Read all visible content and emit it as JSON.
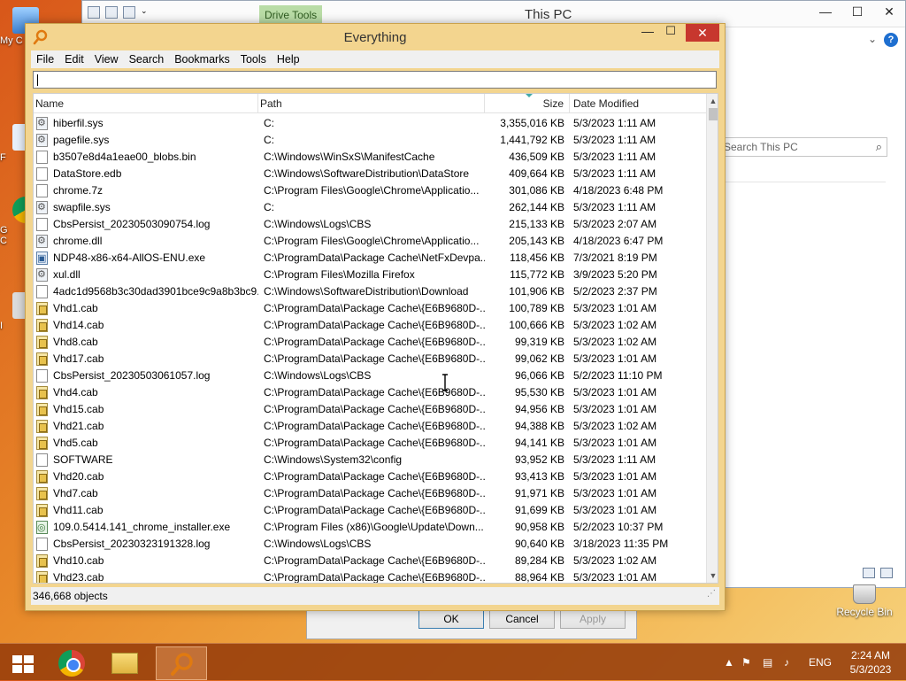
{
  "desktop": {
    "icons": [
      {
        "label": "My C"
      },
      {
        "label": "F"
      },
      {
        "label": "G"
      },
      {
        "label": "C"
      },
      {
        "label": "I"
      }
    ],
    "recycle_bin": "Recycle Bin"
  },
  "explorer": {
    "title": "This PC",
    "drive_tools": "Drive Tools",
    "search_placeholder": "Search This PC",
    "help": "?",
    "minimize": "—",
    "maximize": "☐",
    "close": "✕",
    "chevron": "⌄"
  },
  "properties_dialog": {
    "ok": "OK",
    "cancel": "Cancel",
    "apply": "Apply"
  },
  "everything": {
    "title": "Everything",
    "minimize": "—",
    "maximize": "☐",
    "close": "✕",
    "menu": [
      "File",
      "Edit",
      "View",
      "Search",
      "Bookmarks",
      "Tools",
      "Help"
    ],
    "search_value": "",
    "columns": {
      "name": "Name",
      "path": "Path",
      "size": "Size",
      "date": "Date Modified"
    },
    "rows": [
      {
        "icon": "system-file-icon",
        "name": "hiberfil.sys",
        "path": "C:",
        "size": "3,355,016 KB",
        "date": "5/3/2023 1:11 AM"
      },
      {
        "icon": "system-file-icon",
        "name": "pagefile.sys",
        "path": "C:",
        "size": "1,441,792 KB",
        "date": "5/3/2023 1:11 AM"
      },
      {
        "icon": "file-icon",
        "name": "b3507e8d4a1eae00_blobs.bin",
        "path": "C:\\Windows\\WinSxS\\ManifestCache",
        "size": "436,509 KB",
        "date": "5/3/2023 1:11 AM"
      },
      {
        "icon": "file-icon",
        "name": "DataStore.edb",
        "path": "C:\\Windows\\SoftwareDistribution\\DataStore",
        "size": "409,664 KB",
        "date": "5/3/2023 1:11 AM"
      },
      {
        "icon": "file-icon",
        "name": "chrome.7z",
        "path": "C:\\Program Files\\Google\\Chrome\\Applicatio...",
        "size": "301,086 KB",
        "date": "4/18/2023 6:48 PM"
      },
      {
        "icon": "system-file-icon",
        "name": "swapfile.sys",
        "path": "C:",
        "size": "262,144 KB",
        "date": "5/3/2023 1:11 AM"
      },
      {
        "icon": "file-icon",
        "name": "CbsPersist_20230503090754.log",
        "path": "C:\\Windows\\Logs\\CBS",
        "size": "215,133 KB",
        "date": "5/3/2023 2:07 AM"
      },
      {
        "icon": "system-file-icon",
        "name": "chrome.dll",
        "path": "C:\\Program Files\\Google\\Chrome\\Applicatio...",
        "size": "205,143 KB",
        "date": "4/18/2023 6:47 PM"
      },
      {
        "icon": "exe-icon",
        "name": "NDP48-x86-x64-AllOS-ENU.exe",
        "path": "C:\\ProgramData\\Package Cache\\NetFxDevpa...",
        "size": "118,456 KB",
        "date": "7/3/2021 8:19 PM"
      },
      {
        "icon": "system-file-icon",
        "name": "xul.dll",
        "path": "C:\\Program Files\\Mozilla Firefox",
        "size": "115,772 KB",
        "date": "3/9/2023 5:20 PM"
      },
      {
        "icon": "file-icon",
        "name": "4adc1d9568b3c30dad3901bce9c9a8b3bc9...",
        "path": "C:\\Windows\\SoftwareDistribution\\Download",
        "size": "101,906 KB",
        "date": "5/2/2023 2:37 PM"
      },
      {
        "icon": "cab-icon",
        "name": "Vhd1.cab",
        "path": "C:\\ProgramData\\Package Cache\\{E6B9680D-...",
        "size": "100,789 KB",
        "date": "5/3/2023 1:01 AM"
      },
      {
        "icon": "cab-icon",
        "name": "Vhd14.cab",
        "path": "C:\\ProgramData\\Package Cache\\{E6B9680D-...",
        "size": "100,666 KB",
        "date": "5/3/2023 1:02 AM"
      },
      {
        "icon": "cab-icon",
        "name": "Vhd8.cab",
        "path": "C:\\ProgramData\\Package Cache\\{E6B9680D-...",
        "size": "99,319 KB",
        "date": "5/3/2023 1:02 AM"
      },
      {
        "icon": "cab-icon",
        "name": "Vhd17.cab",
        "path": "C:\\ProgramData\\Package Cache\\{E6B9680D-...",
        "size": "99,062 KB",
        "date": "5/3/2023 1:01 AM"
      },
      {
        "icon": "file-icon",
        "name": "CbsPersist_20230503061057.log",
        "path": "C:\\Windows\\Logs\\CBS",
        "size": "96,066 KB",
        "date": "5/2/2023 11:10 PM"
      },
      {
        "icon": "cab-icon",
        "name": "Vhd4.cab",
        "path": "C:\\ProgramData\\Package Cache\\{E6B9680D-...",
        "size": "95,530 KB",
        "date": "5/3/2023 1:01 AM"
      },
      {
        "icon": "cab-icon",
        "name": "Vhd15.cab",
        "path": "C:\\ProgramData\\Package Cache\\{E6B9680D-...",
        "size": "94,956 KB",
        "date": "5/3/2023 1:01 AM"
      },
      {
        "icon": "cab-icon",
        "name": "Vhd21.cab",
        "path": "C:\\ProgramData\\Package Cache\\{E6B9680D-...",
        "size": "94,388 KB",
        "date": "5/3/2023 1:02 AM"
      },
      {
        "icon": "cab-icon",
        "name": "Vhd5.cab",
        "path": "C:\\ProgramData\\Package Cache\\{E6B9680D-...",
        "size": "94,141 KB",
        "date": "5/3/2023 1:01 AM"
      },
      {
        "icon": "file-icon",
        "name": "SOFTWARE",
        "path": "C:\\Windows\\System32\\config",
        "size": "93,952 KB",
        "date": "5/3/2023 1:11 AM"
      },
      {
        "icon": "cab-icon",
        "name": "Vhd20.cab",
        "path": "C:\\ProgramData\\Package Cache\\{E6B9680D-...",
        "size": "93,413 KB",
        "date": "5/3/2023 1:01 AM"
      },
      {
        "icon": "cab-icon",
        "name": "Vhd7.cab",
        "path": "C:\\ProgramData\\Package Cache\\{E6B9680D-...",
        "size": "91,971 KB",
        "date": "5/3/2023 1:01 AM"
      },
      {
        "icon": "cab-icon",
        "name": "Vhd11.cab",
        "path": "C:\\ProgramData\\Package Cache\\{E6B9680D-...",
        "size": "91,699 KB",
        "date": "5/3/2023 1:01 AM"
      },
      {
        "icon": "installer-icon",
        "name": "109.0.5414.141_chrome_installer.exe",
        "path": "C:\\Program Files (x86)\\Google\\Update\\Down...",
        "size": "90,958 KB",
        "date": "5/2/2023 10:37 PM"
      },
      {
        "icon": "file-icon",
        "name": "CbsPersist_20230323191328.log",
        "path": "C:\\Windows\\Logs\\CBS",
        "size": "90,640 KB",
        "date": "3/18/2023 11:35 PM"
      },
      {
        "icon": "cab-icon",
        "name": "Vhd10.cab",
        "path": "C:\\ProgramData\\Package Cache\\{E6B9680D-...",
        "size": "89,284 KB",
        "date": "5/3/2023 1:02 AM"
      },
      {
        "icon": "cab-icon",
        "name": "Vhd23.cab",
        "path": "C:\\ProgramData\\Package Cache\\{E6B9680D-...",
        "size": "88,964 KB",
        "date": "5/3/2023 1:01 AM"
      }
    ],
    "status": "346,668 objects"
  },
  "taskbar": {
    "items": [
      "start-button",
      "chrome-icon",
      "file-explorer-icon",
      "everything-icon"
    ],
    "tray": {
      "language": "ENG",
      "time": "2:24 AM",
      "date": "5/3/2023"
    }
  },
  "colors": {
    "everything_frame": "#f3d58f",
    "close_red": "#c7372e",
    "taskbar": "#963c0a",
    "drive_tools": "#b9dca6"
  }
}
